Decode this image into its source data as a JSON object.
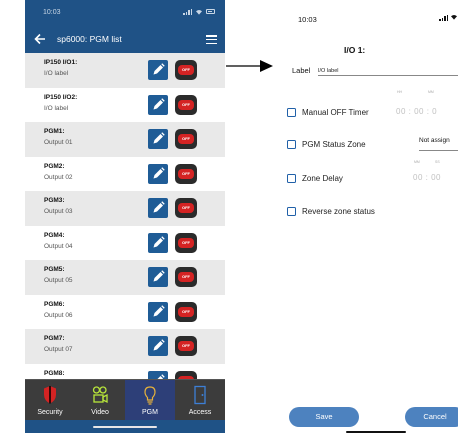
{
  "left_screen": {
    "status_time": "10:03",
    "header_title": "sp6000: PGM list",
    "items": [
      {
        "name": "IP150 I/O1:",
        "label": "I/O label",
        "off": "OFF"
      },
      {
        "name": "IP150 I/O2:",
        "label": "I/O label",
        "off": "OFF"
      },
      {
        "name": "PGM1:",
        "label": "Output 01",
        "off": "OFF"
      },
      {
        "name": "PGM2:",
        "label": "Output 02",
        "off": "OFF"
      },
      {
        "name": "PGM3:",
        "label": "Output 03",
        "off": "OFF"
      },
      {
        "name": "PGM4:",
        "label": "Output 04",
        "off": "OFF"
      },
      {
        "name": "PGM5:",
        "label": "Output 05",
        "off": "OFF"
      },
      {
        "name": "PGM6:",
        "label": "Output 06",
        "off": "OFF"
      },
      {
        "name": "PGM7:",
        "label": "Output 07",
        "off": "OFF"
      },
      {
        "name": "PGM8:",
        "label": "",
        "off": "OFF"
      }
    ],
    "tabs": {
      "security": "Security",
      "video": "Video",
      "pgm": "PGM",
      "access": "Access"
    }
  },
  "right_screen": {
    "status_time": "10:03",
    "title": "I/O 1:",
    "label_caption": "Label",
    "label_value": "I/O label",
    "manual_off_timer": {
      "label": "Manual OFF Timer",
      "unit_hh": "HH",
      "unit_mm": "MM",
      "value": "00 : 00 : 0"
    },
    "pgm_status_zone": {
      "label": "PGM Status Zone",
      "value": "Not assign"
    },
    "zone_delay": {
      "label": "Zone Delay",
      "unit_mm": "MM",
      "unit_ss": "SS",
      "value": "00 : 00"
    },
    "reverse_zone_status": {
      "label": "Reverse zone status"
    },
    "save_label": "Save",
    "cancel_label": "Cancel"
  },
  "colors": {
    "header_blue": "#1f5286",
    "button_blue": "#4d82bf",
    "off_red": "#d42323",
    "tab_active": "#2d3f78"
  }
}
